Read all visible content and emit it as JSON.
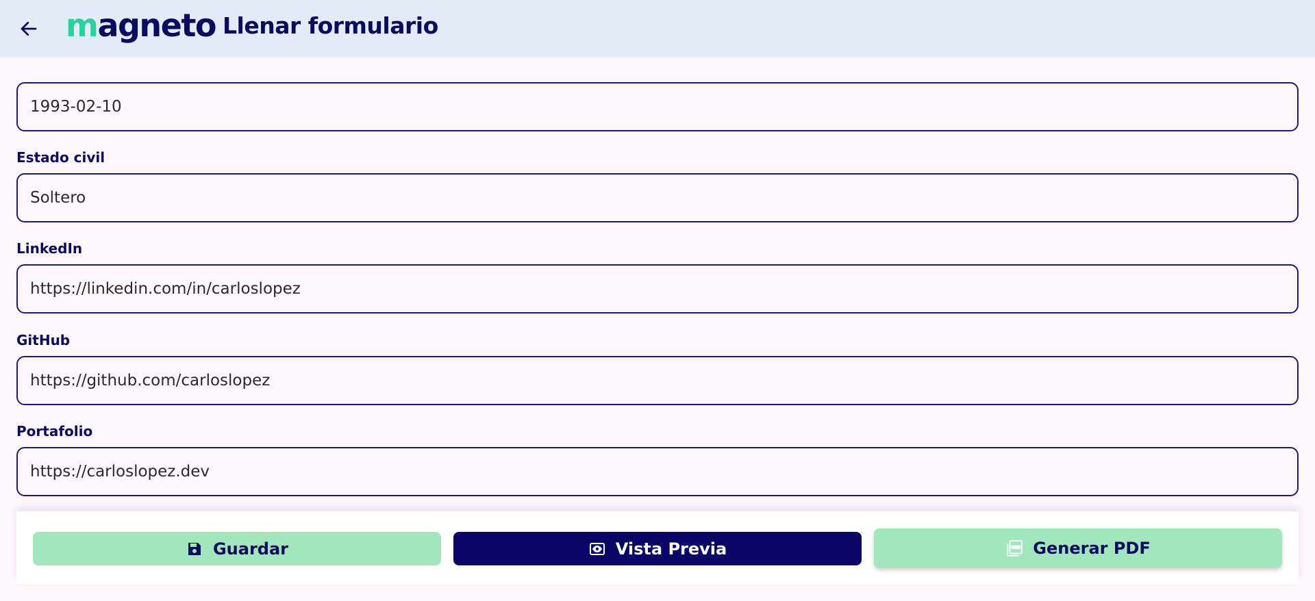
{
  "header": {
    "logo_text_accent": "m",
    "logo_text_rest": "agneto",
    "title": "Llenar formulario",
    "colors": {
      "background": "#e3ebf8",
      "logo_accent": "#27d39a",
      "text": "#0b0b5e"
    }
  },
  "form": {
    "fields": [
      {
        "label": "",
        "value": "1993-02-10"
      },
      {
        "label": "Estado civil",
        "value": "Soltero"
      },
      {
        "label": "LinkedIn",
        "value": "https://linkedin.com/in/carloslopez"
      },
      {
        "label": "GitHub",
        "value": "https://github.com/carloslopez"
      },
      {
        "label": "Portafolio",
        "value": "https://carloslopez.dev"
      }
    ]
  },
  "actions": {
    "save_label": "Guardar",
    "preview_label": "Vista Previa",
    "pdf_label": "Generar PDF",
    "icons": {
      "save": "floppy-disk-icon",
      "preview": "eye-icon",
      "pdf": "pdf-icon"
    },
    "colors": {
      "mint": "#a1e6bd",
      "navy": "#0a0466"
    }
  }
}
